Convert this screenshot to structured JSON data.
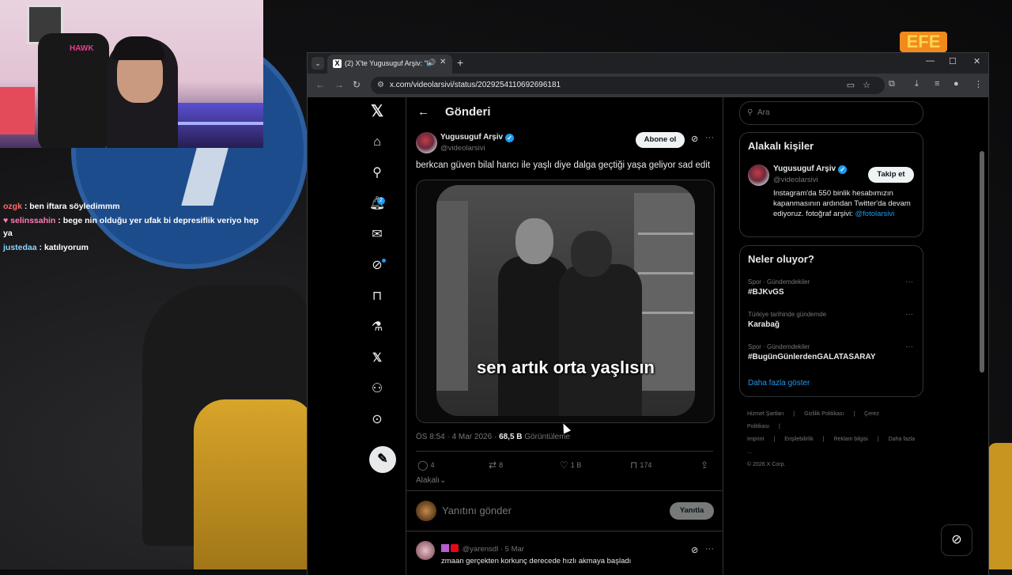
{
  "chat": [
    {
      "user": "ozgk",
      "user_color": "#ff6b6b",
      "text": ": ben iftara söyledimmm"
    },
    {
      "user": "selinssahin",
      "user_color": "#ff7eb6",
      "text": ": bege nin olduğu yer ufak bi depresiflik veriyo hep ya"
    },
    {
      "user": "justedaa",
      "user_color": "#8fd3ff",
      "text": ": katılıyorum"
    }
  ],
  "background": {
    "logo_text": "EFE"
  },
  "browser": {
    "tab_title": "(2) X'te Yugusuguf Arşiv: \"b",
    "url": "x.com/videolarsivi/status/2029254110692696181"
  },
  "x": {
    "page_title": "Gönderi",
    "tweet": {
      "author_name": "Yugusuguf Arşiv",
      "author_handle": "@videolarsivi",
      "subscribe_label": "Abone ol",
      "text": "berkcan güven bilal hancı ile yaşlı diye dalga geçtiği yaşa geliyor sad edit",
      "video_caption": "sen artık orta yaşlısın",
      "timestamp": "ÖS 8:54 · 4 Mar 2026 · ",
      "views_count": "68,5 B",
      "views_label": " Görüntüleme",
      "replies": "4",
      "reposts": "8",
      "likes": "1 B",
      "bookmarks": "174",
      "related_label": "Alakalı"
    },
    "reply": {
      "placeholder": "Yanıtını gönder",
      "button_label": "Yanıtla"
    },
    "comment": {
      "handle": "@yarensdl",
      "date": "· 5 Mar",
      "text": "zmaan gerçekten korkunç derecede hızlı akmaya başladı"
    },
    "notifications_badge": "2",
    "search_placeholder": "Ara",
    "related_people": {
      "title": "Alakalı kişiler",
      "name": "Yugusuguf Arşiv",
      "handle": "@videolarsivi",
      "follow_label": "Takip et",
      "bio": "Instagram'da 550 binlik hesabımızın kapanmasının ardından Twitter'da devam ediyoruz. fotoğraf arşivi: ",
      "bio_link": "@fotolarsivi"
    },
    "trends": {
      "title": "Neler oluyor?",
      "items": [
        {
          "category": "Spor · Gündemdekiler",
          "name": "#BJKvGS"
        },
        {
          "category": "Türkiye tarihinde gündemde",
          "name": "Karabağ"
        },
        {
          "category": "Spor · Gündemdekiler",
          "name": "#BugünGünlerdenGALATASARAY"
        }
      ],
      "show_more": "Daha fazla göster"
    },
    "footer": {
      "links": [
        "Hizmet Şartları",
        "|",
        "Gizlilik Politikası",
        "|",
        "Çerez Politikası",
        "|",
        "Imprint",
        "|",
        "Erişilebilirlik",
        "|",
        "Reklam bilgisi",
        "|",
        "Daha fazla ..."
      ],
      "copyright": "© 2026 X Corp."
    }
  },
  "icons": {
    "x_logo": "x-logo-icon",
    "home": "home-icon",
    "search": "search-icon",
    "notifications": "bell-icon",
    "messages": "mail-icon",
    "grok": "grok-icon",
    "bookmarks": "bookmark-icon",
    "premium": "flask-icon",
    "profile": "person-icon",
    "more": "more-icon"
  }
}
